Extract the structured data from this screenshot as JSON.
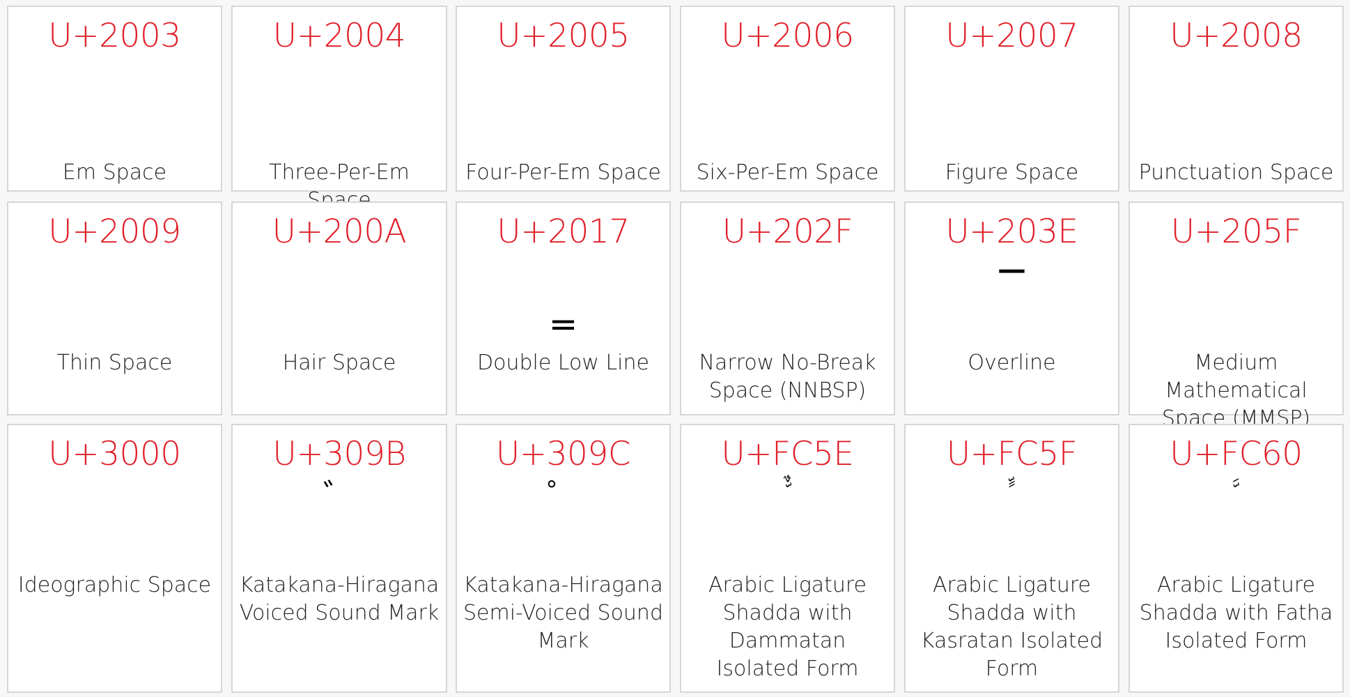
{
  "cells": [
    {
      "code": "U+2003",
      "glyph": " ",
      "name": "Em Space"
    },
    {
      "code": "U+2004",
      "glyph": " ",
      "name": "Three-Per-Em Space"
    },
    {
      "code": "U+2005",
      "glyph": " ",
      "name": "Four-Per-Em Space"
    },
    {
      "code": "U+2006",
      "glyph": " ",
      "name": "Six-Per-Em Space"
    },
    {
      "code": "U+2007",
      "glyph": " ",
      "name": "Figure Space"
    },
    {
      "code": "U+2008",
      "glyph": " ",
      "name": "Punctuation Space"
    },
    {
      "code": "U+2009",
      "glyph": " ",
      "name": "Thin Space"
    },
    {
      "code": "U+200A",
      "glyph": " ",
      "name": "Hair Space"
    },
    {
      "code": "U+2017",
      "glyph": "‗",
      "name": "Double Low Line"
    },
    {
      "code": "U+202F",
      "glyph": " ",
      "name": "Narrow No-Break Space (NNBSP)"
    },
    {
      "code": "U+203E",
      "glyph": "‾",
      "name": "Overline"
    },
    {
      "code": "U+205F",
      "glyph": " ",
      "name": "Medium Mathematical Space (MMSP)"
    },
    {
      "code": "U+3000",
      "glyph": "　",
      "name": "Ideographic Space"
    },
    {
      "code": "U+309B",
      "glyph": "゛",
      "name": "Katakana-Hiragana Voiced Sound Mark"
    },
    {
      "code": "U+309C",
      "glyph": "゜",
      "name": "Katakana-Hiragana Semi-Voiced Sound Mark"
    },
    {
      "code": "U+FC5E",
      "glyph": "ﱞ",
      "name": "Arabic Ligature Shadda with Dammatan Isolated Form"
    },
    {
      "code": "U+FC5F",
      "glyph": "ﱟ",
      "name": "Arabic Ligature Shadda with Kasratan Isolated Form"
    },
    {
      "code": "U+FC60",
      "glyph": "ﱠ",
      "name": "Arabic Ligature Shadda with Fatha Isolated Form"
    }
  ]
}
